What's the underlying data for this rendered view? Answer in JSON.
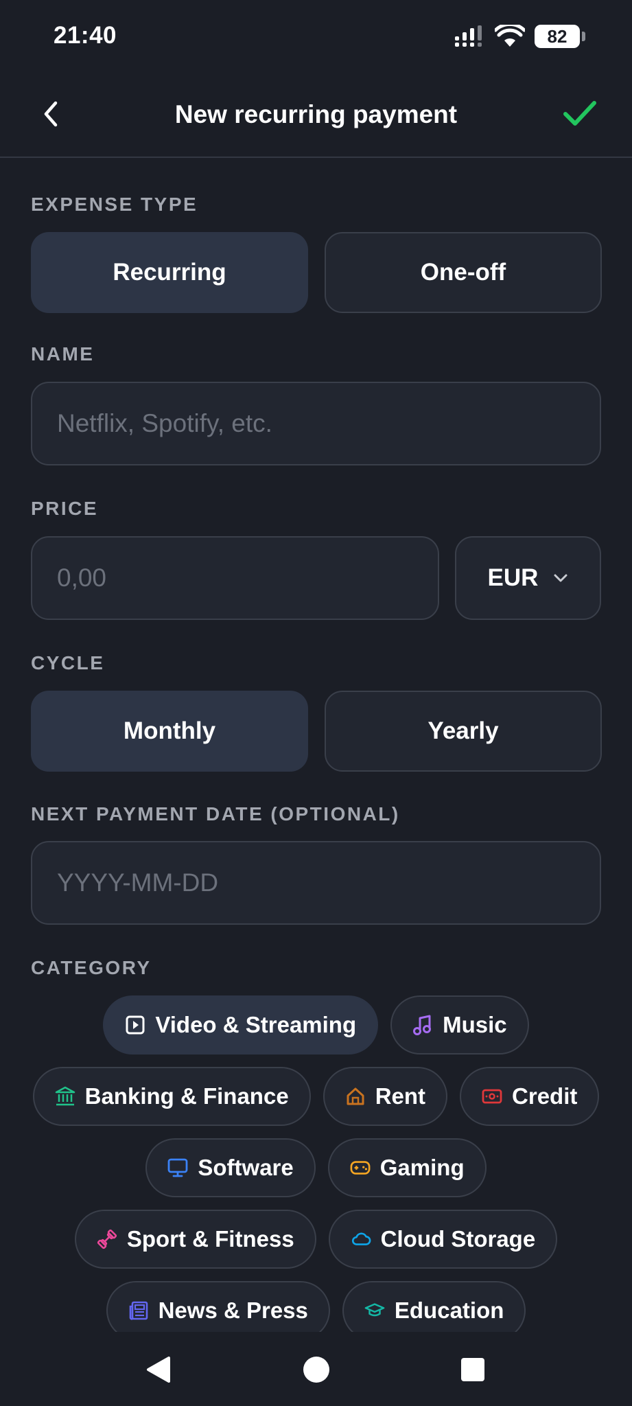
{
  "status_bar": {
    "time": "21:40",
    "battery": "82"
  },
  "header": {
    "title": "New recurring payment"
  },
  "expense_type": {
    "label": "EXPENSE TYPE",
    "options": [
      "Recurring",
      "One-off"
    ],
    "selected": "Recurring"
  },
  "name": {
    "label": "NAME",
    "placeholder": "Netflix, Spotify, etc."
  },
  "price": {
    "label": "PRICE",
    "placeholder": "0,00",
    "currency": "EUR"
  },
  "cycle": {
    "label": "CYCLE",
    "options": [
      "Monthly",
      "Yearly"
    ],
    "selected": "Monthly"
  },
  "next_payment": {
    "label": "NEXT PAYMENT DATE (OPTIONAL)",
    "placeholder": "YYYY-MM-DD"
  },
  "category": {
    "label": "CATEGORY",
    "selected": "Video & Streaming",
    "items": [
      {
        "label": "Video & Streaming",
        "icon": "play-icon",
        "color": "#ffffff"
      },
      {
        "label": "Music",
        "icon": "music-note-icon",
        "color": "#a66cf2"
      },
      {
        "label": "Banking & Finance",
        "icon": "bank-icon",
        "color": "#20c28a"
      },
      {
        "label": "Rent",
        "icon": "house-icon",
        "color": "#c9731f"
      },
      {
        "label": "Credit",
        "icon": "cash-icon",
        "color": "#e0383a"
      },
      {
        "label": "Software",
        "icon": "monitor-icon",
        "color": "#3b82f6"
      },
      {
        "label": "Gaming",
        "icon": "gamepad-icon",
        "color": "#f5a623"
      },
      {
        "label": "Sport & Fitness",
        "icon": "dumbbell-icon",
        "color": "#ec4899"
      },
      {
        "label": "Cloud Storage",
        "icon": "cloud-icon",
        "color": "#0ea5e9"
      },
      {
        "label": "News & Press",
        "icon": "newspaper-icon",
        "color": "#6366f1"
      },
      {
        "label": "Education",
        "icon": "graduation-cap-icon",
        "color": "#14b8a6"
      }
    ]
  },
  "colors": {
    "background": "#1b1e26",
    "surface": "#222630",
    "active": "#2d3546",
    "accent": "#22c55e",
    "label": "#a3a7b0"
  }
}
